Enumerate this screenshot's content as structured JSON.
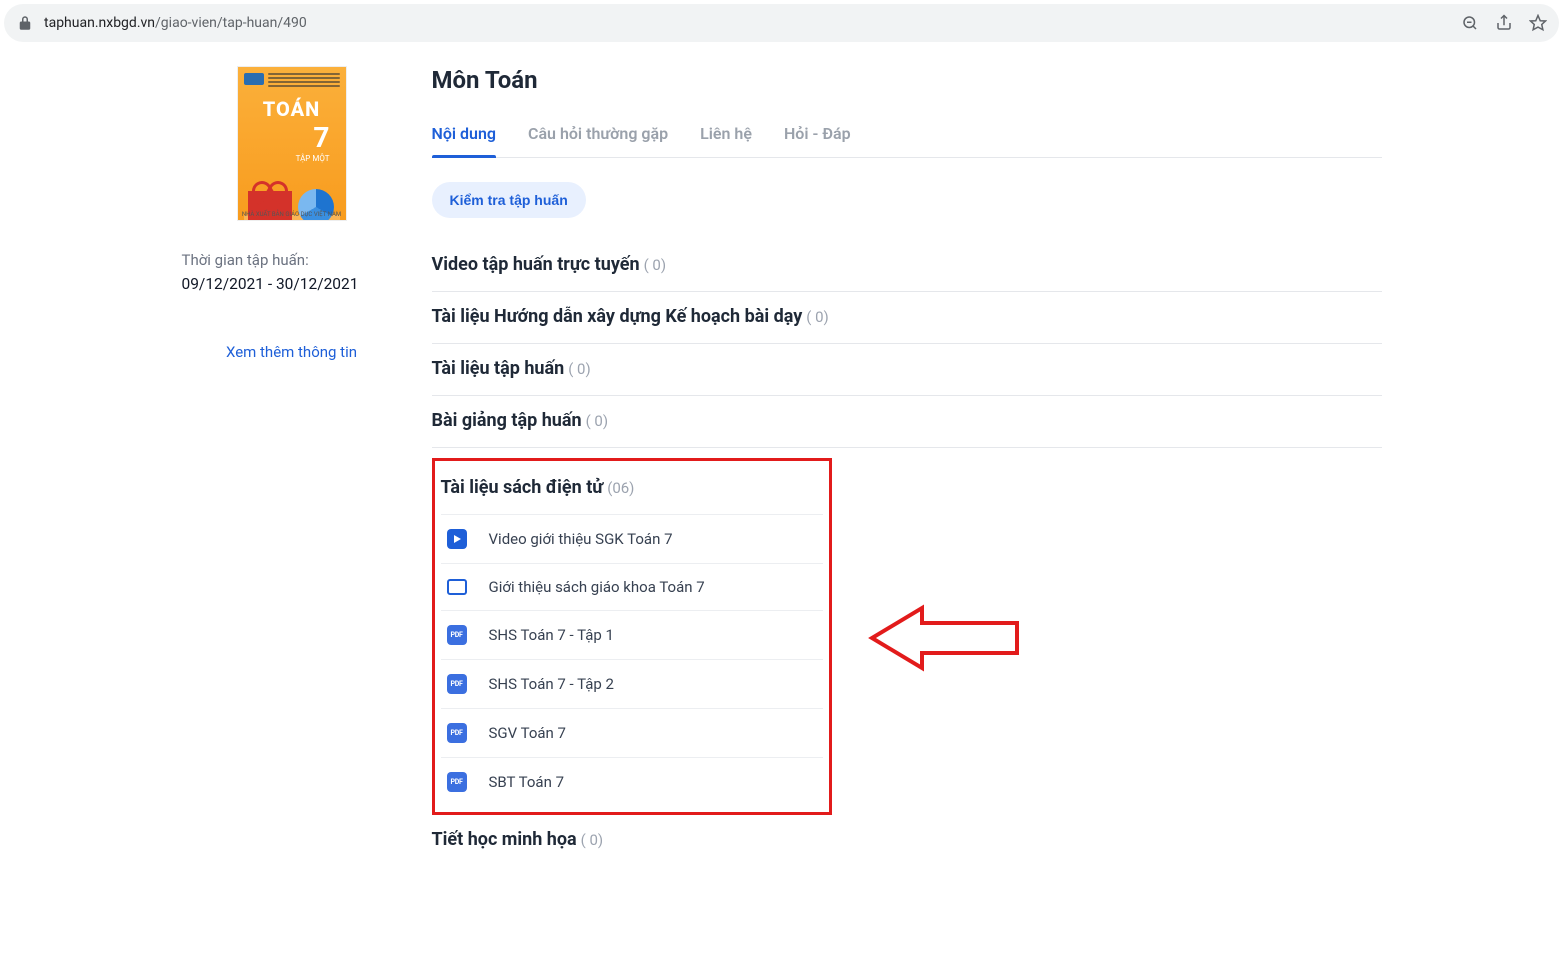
{
  "url": {
    "host": "taphuan.nxbgd.vn",
    "path": "/giao-vien/tap-huan/490"
  },
  "book": {
    "title_line": "TOÁN",
    "grade": "7",
    "volume": "TẬP MỘT",
    "publisher_footer": "NHÀ XUẤT BẢN GIÁO DỤC VIỆT NAM"
  },
  "sidebar": {
    "time_label": "Thời gian tập huấn:",
    "dates": "09/12/2021 - 30/12/2021",
    "more_link": "Xem thêm thông tin"
  },
  "page": {
    "title": "Môn Toán"
  },
  "tabs": [
    {
      "label": "Nội dung",
      "active": true
    },
    {
      "label": "Câu hỏi thường gặp",
      "active": false
    },
    {
      "label": "Liên hệ",
      "active": false
    },
    {
      "label": "Hỏi - Đáp",
      "active": false
    }
  ],
  "exam_button": "Kiểm tra tập huấn",
  "sections": {
    "video_online": {
      "title": "Video tập huấn trực tuyến",
      "count": "( 0)"
    },
    "guide": {
      "title": "Tài liệu Hướng dẫn xây dựng Kế hoạch bài dạy",
      "count": "( 0)"
    },
    "materials": {
      "title": "Tài liệu tập huấn",
      "count": "( 0)"
    },
    "lectures": {
      "title": "Bài giảng tập huấn",
      "count": "( 0)"
    },
    "ebooks": {
      "title": "Tài liệu sách điện tử",
      "count": "(06)"
    },
    "sample_lesson": {
      "title": "Tiết học minh họa",
      "count": "( 0)"
    }
  },
  "pdf_badge_text": "PDF",
  "ebook_items": [
    {
      "type": "video",
      "label": "Video giới thiệu SGK Toán 7"
    },
    {
      "type": "slide",
      "label": "Giới thiệu sách giáo khoa Toán 7"
    },
    {
      "type": "pdf",
      "label": "SHS Toán 7 - Tập 1"
    },
    {
      "type": "pdf",
      "label": "SHS Toán 7 - Tập 2"
    },
    {
      "type": "pdf",
      "label": "SGV Toán 7"
    },
    {
      "type": "pdf",
      "label": "SBT Toán 7"
    }
  ]
}
